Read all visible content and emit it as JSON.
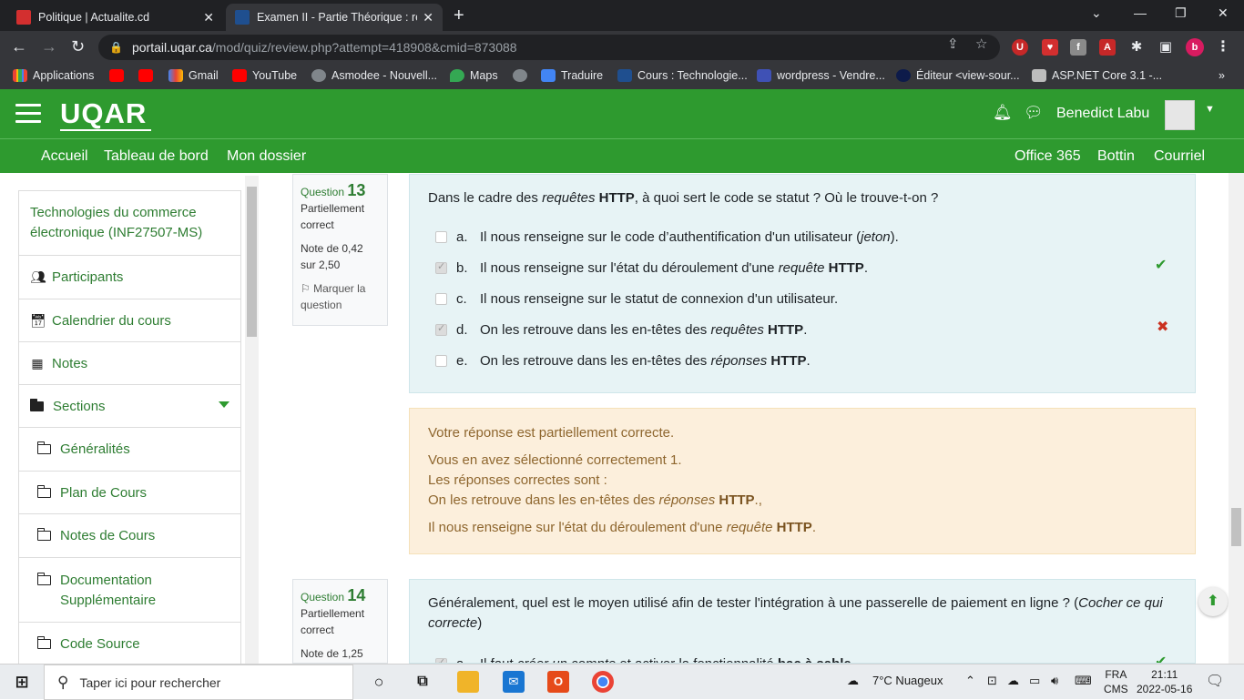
{
  "browser": {
    "tabs": [
      {
        "title": "Politique | Actualite.cd",
        "active": false
      },
      {
        "title": "Examen II - Partie Théorique : relect",
        "active": true
      }
    ],
    "url_host": "portail.uqar.ca",
    "url_path": "/mod/quiz/review.php?attempt=418908&cmid=873088",
    "bookmarks": [
      "Applications",
      "Gmail",
      "YouTube",
      "Asmodee - Nouvell...",
      "Maps",
      "Traduire",
      "Cours : Technologie...",
      "wordpress - Vendre...",
      "Éditeur <view-sour...",
      "ASP.NET Core 3.1 -..."
    ],
    "overflow": "»",
    "profile_initial": "b"
  },
  "site": {
    "logo": "UQAR",
    "user_name": "Benedict Labu",
    "nav_left": [
      "Accueil",
      "Tableau de bord",
      "Mon dossier"
    ],
    "nav_right": [
      "Office 365",
      "Bottin",
      "Courriel"
    ]
  },
  "course_nav": {
    "course_title": "Technologies du commerce électronique (INF27507-MS)",
    "items": [
      {
        "label": "Participants",
        "icon": "users-icon"
      },
      {
        "label": "Calendrier du cours",
        "icon": "calendar-icon"
      },
      {
        "label": "Notes",
        "icon": "table-icon"
      },
      {
        "label": "Sections",
        "icon": "folder-icon"
      }
    ],
    "sections": [
      "Généralités",
      "Plan de Cours",
      "Notes de Cours",
      "Documentation Supplémentaire",
      "Code Source"
    ]
  },
  "question13": {
    "label": "Question",
    "number": "13",
    "state": "Partiellement correct",
    "grade": "Note de 0,42 sur 2,50",
    "flag": "Marquer la question",
    "text_before": "Dans le cadre des ",
    "text_em": "requêtes",
    "text_bold": " HTTP",
    "text_after": ", à quoi sert le code se statut ? Où le trouve-t-on ?",
    "answers": [
      {
        "letter": "a.",
        "pre": "Il nous renseigne sur le code d’authentification d'un utilisateur (",
        "em": "jeton",
        "bold": "",
        "post": ").",
        "checked": false,
        "mark": ""
      },
      {
        "letter": "b.",
        "pre": "Il nous renseigne sur l'état du déroulement d'une ",
        "em": "requête",
        "bold": " HTTP",
        "post": ".",
        "checked": true,
        "mark": "correct"
      },
      {
        "letter": "c.",
        "pre": "Il nous renseigne sur le statut de connexion d'un utilisateur.",
        "em": "",
        "bold": "",
        "post": "",
        "checked": false,
        "mark": ""
      },
      {
        "letter": "d.",
        "pre": "On les retrouve dans les en-têtes des ",
        "em": "requêtes",
        "bold": " HTTP",
        "post": ".",
        "checked": true,
        "mark": "incorrect"
      },
      {
        "letter": "e.",
        "pre": "On les retrouve dans les en-têtes des ",
        "em": "réponses",
        "bold": " HTTP",
        "post": ".",
        "checked": false,
        "mark": ""
      }
    ]
  },
  "feedback13": {
    "summary": "Votre réponse est partiellement correcte.",
    "selected": "Vous en avez sélectionné correctement 1.",
    "correct_intro": "Les réponses correctes sont :",
    "line1_pre": "On les retrouve dans les en-têtes des ",
    "line1_em": "réponses",
    "line1_bold": " HTTP",
    "line1_post": ".,",
    "line2_pre": "Il nous renseigne sur l'état du déroulement d'une ",
    "line2_em": "requête",
    "line2_bold": " HTTP",
    "line2_post": "."
  },
  "question14": {
    "label": "Question",
    "number": "14",
    "state": "Partiellement correct",
    "grade": "Note de 1,25",
    "text": "Généralement, quel est le moyen utilisé afin de tester l'intégration à une passerelle de paiement en ligne ? (",
    "text_em": "Cocher ce qui correcte",
    "text_after": ")",
    "answer_a_pre": "Il faut ",
    "answer_a_em": "créer un compte",
    "answer_a_mid": " et activer la fonctionnalité ",
    "answer_a_bold": "bac à sable",
    "answer_a_post": "."
  },
  "taskbar": {
    "search_placeholder": "Taper ici pour rechercher",
    "weather": "7°C  Nuageux",
    "lang_top": "FRA",
    "lang_bottom": "CMS",
    "time": "21:11",
    "date": "2022-05-16"
  },
  "colors": {
    "brand_green": "#2e9a2f",
    "correct": "#2e9a2f",
    "incorrect": "#ca3120"
  }
}
